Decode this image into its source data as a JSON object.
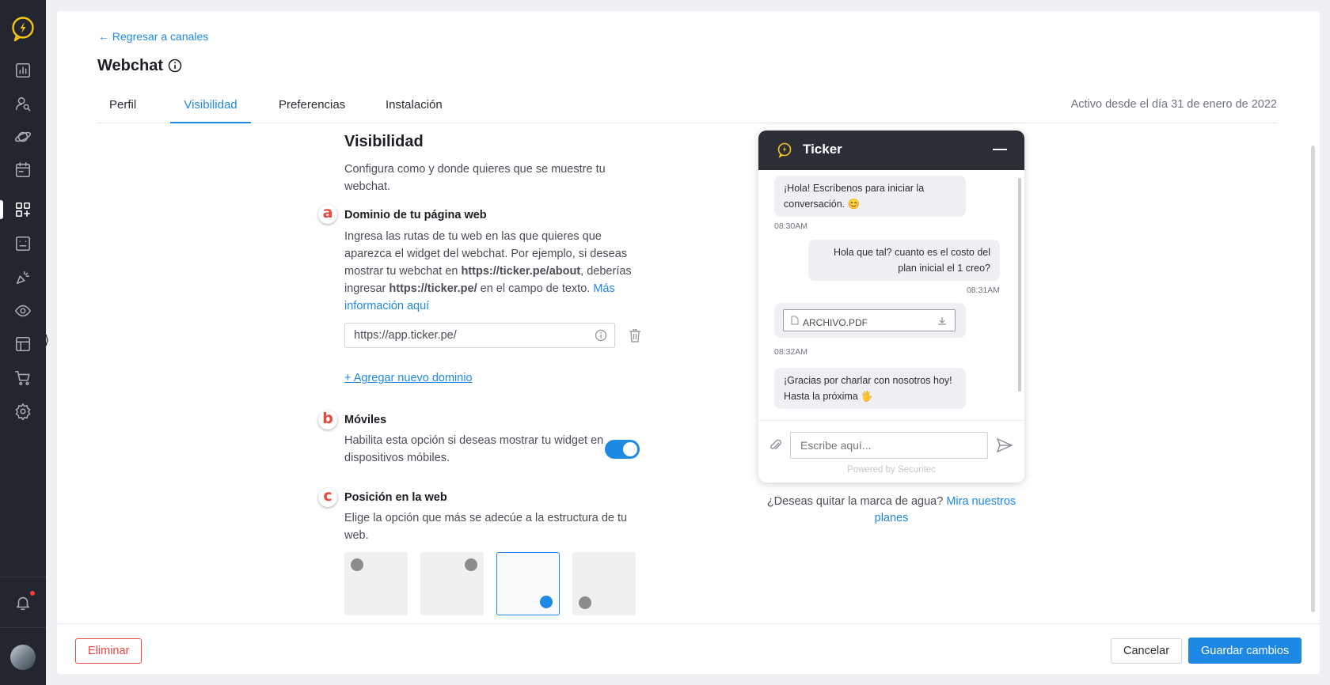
{
  "sidebar": {
    "items": [
      {
        "icon": "dashboard-chart-icon"
      },
      {
        "icon": "contacts-search-icon"
      },
      {
        "icon": "planet-icon"
      },
      {
        "icon": "calendar-icon"
      },
      {
        "icon": "apps-grid-icon",
        "active": true
      },
      {
        "icon": "dashboard-panel-icon"
      },
      {
        "icon": "megaphone-icon"
      },
      {
        "icon": "eye-icon"
      },
      {
        "icon": "layout-icon"
      },
      {
        "icon": "cart-icon"
      },
      {
        "icon": "gear-icon"
      }
    ],
    "notifications_badge_color": "#ff3b3b",
    "expand_glyph": "⟩"
  },
  "header": {
    "back_label": "Regresar a canales",
    "title": "Webchat",
    "active_since": "Activo desde el día 31 de enero de 2022"
  },
  "tabs": [
    {
      "label": "Perfil"
    },
    {
      "label": "Visibilidad",
      "active": true
    },
    {
      "label": "Preferencias"
    },
    {
      "label": "Instalación"
    }
  ],
  "visibility": {
    "title": "Visibilidad",
    "description": "Configura como y donde quieres que se muestre tu webchat.",
    "domain": {
      "letter": "a",
      "title": "Dominio de tu página web",
      "desc_part1": "Ingresa las rutas de tu web en las que quieres que aparezca el widget del webchat. Por ejemplo, si deseas mostrar tu webchat en ",
      "example_url": "https://ticker.pe/about",
      "desc_part2": ", deberías ingresar ",
      "example_domain": "https://ticker.pe/",
      "desc_part3": " en el campo de texto. ",
      "more_info_link": "Más información aquí",
      "input_value": "https://app.ticker.pe/",
      "add_domain_label": "+ Agregar nuevo dominio"
    },
    "mobile": {
      "letter": "b",
      "title": "Móviles",
      "desc": "Habilita esta opción si deseas mostrar tu widget en dispositivos móbiles.",
      "enabled": true
    },
    "position": {
      "letter": "c",
      "title": "Posición en la web",
      "desc": "Elige la opción que más se adecúe a la estructura de tu web.",
      "options": [
        "top-left",
        "top-right",
        "bottom-right",
        "bottom-left"
      ],
      "selected": "bottom-right"
    }
  },
  "widget": {
    "name": "Ticker",
    "messages": [
      {
        "from": "bot",
        "text": "¡Hola! Escríbenos para iniciar la conversación. 😊",
        "time": "08:30AM"
      },
      {
        "from": "user",
        "text": "Hola que tal? cuanto es el costo del plan inicial el 1 creo?",
        "time": "08:31AM"
      },
      {
        "from": "bot",
        "file": "ARCHIVO.PDF",
        "time": "08:32AM"
      },
      {
        "from": "bot",
        "text": "¡Gracias por charlar con nosotros hoy! Hasta la próxima 🖐",
        "time": ""
      }
    ],
    "input_placeholder": "Escribe aquí...",
    "powered_by": "Powered by Securitec",
    "accent": "#1e88e5",
    "header_color": "#2b2e36"
  },
  "watermark": {
    "question": "¿Deseas quitar la marca de agua?",
    "link": "Mira nuestros planes"
  },
  "footer": {
    "delete_label": "Eliminar",
    "cancel_label": "Cancelar",
    "save_label": "Guardar cambios"
  }
}
